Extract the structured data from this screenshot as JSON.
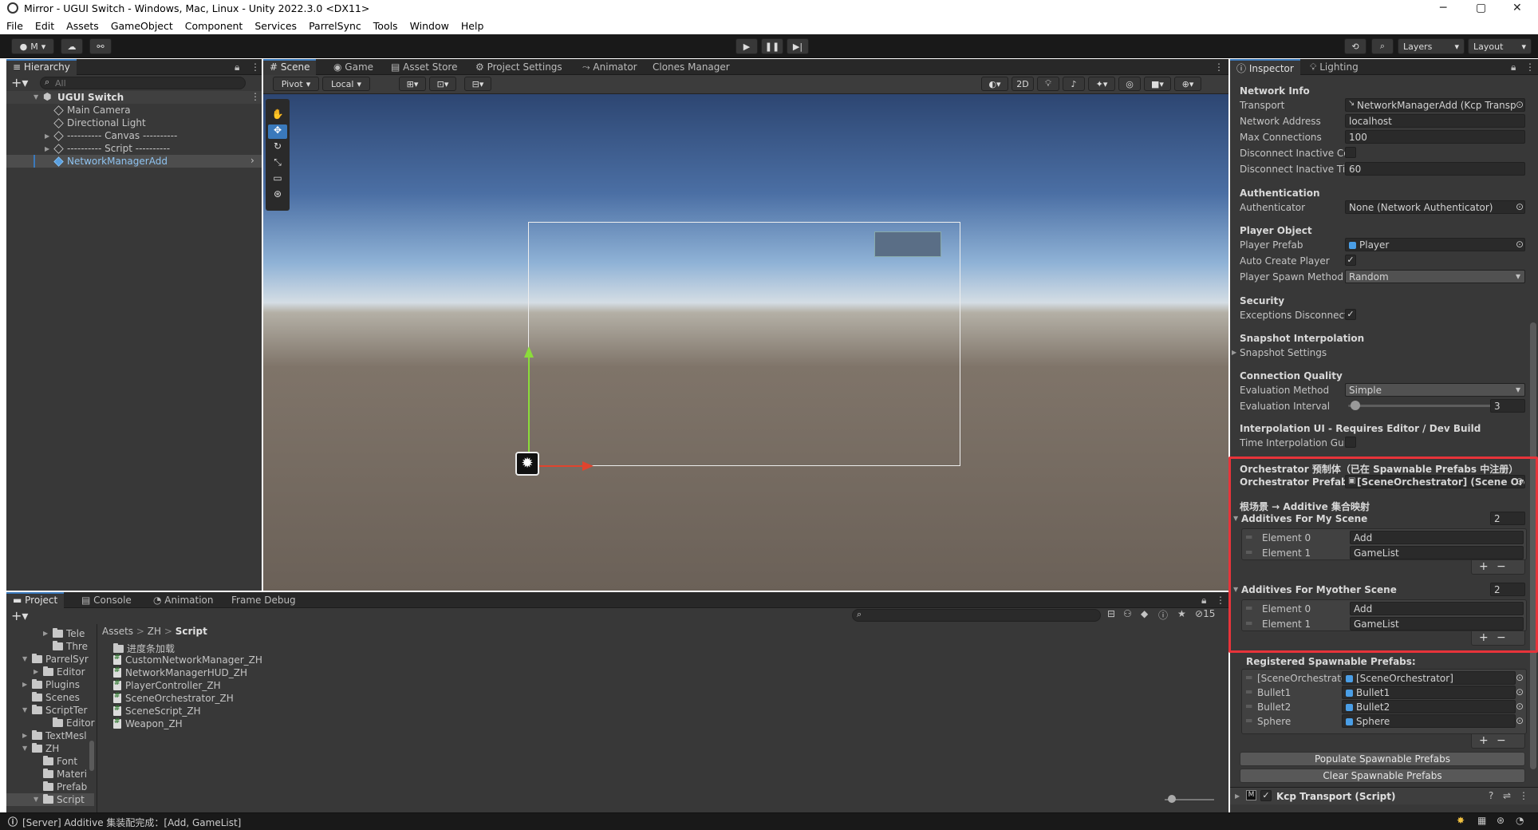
{
  "window": {
    "title": "Mirror - UGUI Switch - Windows, Mac, Linux - Unity 2022.3.0 <DX11>",
    "min": "─",
    "max": "▢",
    "close": "✕"
  },
  "menu": [
    "File",
    "Edit",
    "Assets",
    "GameObject",
    "Component",
    "Services",
    "ParrelSync",
    "Tools",
    "Window",
    "Help"
  ],
  "toolbar": {
    "account": "M",
    "layers": "Layers",
    "layout": "Layout"
  },
  "hierarchy": {
    "title": "Hierarchy",
    "search_placeholder": "All",
    "scene": "UGUI Switch",
    "items": [
      "Main Camera",
      "Directional Light",
      "---------- Canvas ----------",
      "---------- Script ----------",
      "NetworkManagerAdd"
    ]
  },
  "scene_tabs": [
    "Scene",
    "Game",
    "Asset Store",
    "Project Settings",
    "Animator",
    "Clones Manager"
  ],
  "scene_toolbar": {
    "pivot": "Pivot",
    "local": "Local",
    "mode2d": "2D"
  },
  "bottom_tabs": [
    "Project",
    "Console",
    "Animation",
    "Frame Debug"
  ],
  "project": {
    "tree": [
      "Tele",
      "Thre",
      "ParrelSyr",
      "Editor",
      "Plugins",
      "Scenes",
      "ScriptTer",
      "Editor",
      "TextMesl",
      "ZH",
      "Font",
      "Materi",
      "Prefab",
      "Script"
    ],
    "breadcrumb": [
      "Assets",
      "ZH",
      "Script"
    ],
    "files": [
      "进度条加载",
      "CustomNetworkManager_ZH",
      "NetworkManagerHUD_ZH",
      "PlayerController_ZH",
      "SceneOrchestrator_ZH",
      "SceneScript_ZH",
      "Weapon_ZH"
    ],
    "hidden_count": "15"
  },
  "status": {
    "message": "[Server] Additive 集装配完成：[Add, GameList]"
  },
  "inspector": {
    "tabs": [
      "Inspector",
      "Lighting"
    ],
    "network_info": {
      "header": "Network Info",
      "transport_label": "Transport",
      "transport": "NetworkManagerAdd (Kcp Transp",
      "address_label": "Network Address",
      "address": "localhost",
      "maxconn_label": "Max Connections",
      "maxconn": "100",
      "disc_co_label": "Disconnect Inactive Co",
      "disc_ti_label": "Disconnect Inactive Tir",
      "disc_ti": "60"
    },
    "auth": {
      "header": "Authentication",
      "label": "Authenticator",
      "value": "None (Network Authenticator)"
    },
    "player": {
      "header": "Player Object",
      "prefab_label": "Player Prefab",
      "prefab": "Player",
      "auto_label": "Auto Create Player",
      "spawn_label": "Player Spawn Method",
      "spawn": "Random"
    },
    "security": {
      "header": "Security",
      "exc_label": "Exceptions Disconnect"
    },
    "snapshot": {
      "header": "Snapshot Interpolation",
      "settings": "Snapshot Settings"
    },
    "quality": {
      "header": "Connection Quality",
      "method_label": "Evaluation Method",
      "method": "Simple",
      "interval_label": "Evaluation Interval",
      "interval": "3"
    },
    "interp_ui": {
      "header": "Interpolation UI - Requires Editor / Dev Build",
      "label": "Time Interpolation Gui"
    },
    "orch": {
      "header": "Orchestrator 预制体（已在 Spawnable Prefabs 中注册）",
      "label": "Orchestrator Prefab",
      "value": "[SceneOrchestrator] (Scene Orc"
    },
    "map": {
      "header": "根场景 → Additive 集合映射",
      "list1": "Additives For My Scene",
      "list1_count": "2",
      "list1_items": [
        {
          "name": "Element 0",
          "value": "Add"
        },
        {
          "name": "Element 1",
          "value": "GameList"
        }
      ],
      "list2": "Additives For Myother Scene",
      "list2_count": "2",
      "list2_items": [
        {
          "name": "Element 0",
          "value": "Add"
        },
        {
          "name": "Element 1",
          "value": "GameList"
        }
      ]
    },
    "spawnable": {
      "header": "Registered Spawnable Prefabs:",
      "items": [
        {
          "name": "[SceneOrchestrator]",
          "value": "[SceneOrchestrator]"
        },
        {
          "name": "Bullet1",
          "value": "Bullet1"
        },
        {
          "name": "Bullet2",
          "value": "Bullet2"
        },
        {
          "name": "Sphere",
          "value": "Sphere"
        }
      ],
      "populate": "Populate Spawnable Prefabs",
      "clear": "Clear Spawnable Prefabs"
    },
    "component": "Kcp Transport (Script)"
  },
  "colors": {
    "highlight": "#e8333a",
    "selection": "#2c5d87",
    "accent": "#3a79bb"
  }
}
